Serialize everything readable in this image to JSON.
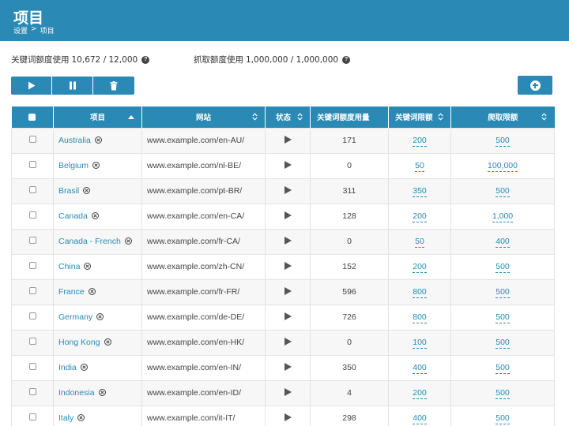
{
  "header": {
    "title": "项目",
    "breadcrumb": [
      "设置",
      ">",
      "项目"
    ]
  },
  "quotas": {
    "keyword": {
      "label": "关键词额度使用",
      "value": "10,672 / 12,000",
      "icon": "?"
    },
    "crawl": {
      "label": "抓取额度使用",
      "value": "1,000,000 / 1,000,000",
      "icon": "?"
    }
  },
  "toolbar": {
    "buttons": [
      "play-icon",
      "pause-icon",
      "trash-icon"
    ],
    "add_button": "plus-circle-icon"
  },
  "table": {
    "columns": [
      "",
      "项目",
      "网站",
      "状态",
      "关键词额度用量",
      "关键词限额",
      "爬取限额"
    ],
    "rows": [
      {
        "project": "Australia",
        "url": "www.example.com/en-AU/",
        "usage": "171",
        "kw_limit": "200",
        "crawl_limit": "500"
      },
      {
        "project": "Belgium",
        "url": "www.example.com/nl-BE/",
        "usage": "0",
        "kw_limit": "50",
        "crawl_limit": "100,000"
      },
      {
        "project": "Brasil",
        "url": "www.example.com/pt-BR/",
        "usage": "311",
        "kw_limit": "350",
        "crawl_limit": "500"
      },
      {
        "project": "Canada",
        "url": "www.example.com/en-CA/",
        "usage": "128",
        "kw_limit": "200",
        "crawl_limit": "1,000"
      },
      {
        "project": "Canada - French",
        "url": "www.example.com/fr-CA/",
        "usage": "0",
        "kw_limit": "50",
        "crawl_limit": "400"
      },
      {
        "project": "China",
        "url": "www.example.com/zh-CN/",
        "usage": "152",
        "kw_limit": "200",
        "crawl_limit": "500"
      },
      {
        "project": "France",
        "url": "www.example.com/fr-FR/",
        "usage": "596",
        "kw_limit": "800",
        "crawl_limit": "500"
      },
      {
        "project": "Germany",
        "url": "www.example.com/de-DE/",
        "usage": "726",
        "kw_limit": "800",
        "crawl_limit": "500"
      },
      {
        "project": "Hong Kong",
        "url": "www.example.com/en-HK/",
        "usage": "0",
        "kw_limit": "100",
        "crawl_limit": "500"
      },
      {
        "project": "India",
        "url": "www.example.com/en-IN/",
        "usage": "350",
        "kw_limit": "400",
        "crawl_limit": "500"
      },
      {
        "project": "Indonesia",
        "url": "www.example.com/en-ID/",
        "usage": "4",
        "kw_limit": "200",
        "crawl_limit": "500"
      },
      {
        "project": "Italy",
        "url": "www.example.com/it-IT/",
        "usage": "298",
        "kw_limit": "400",
        "crawl_limit": "500"
      }
    ]
  },
  "colors": {
    "accent": "#2a8ab5",
    "row_alt": "#f7f7f7"
  }
}
